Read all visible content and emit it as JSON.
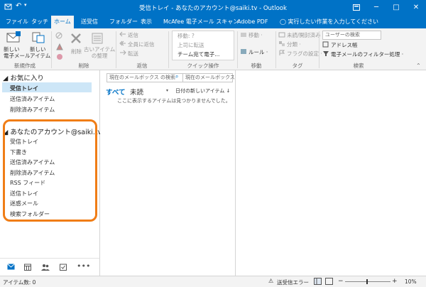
{
  "title_bar": {
    "title": "受信トレイ - あなたのアカウント@saiki.tv - Outlook",
    "ribbon_options_icon": "ribbon-display-options-icon",
    "minimize": "─",
    "maximize": "□",
    "close": "✕"
  },
  "tabs": [
    {
      "label": "ファイル"
    },
    {
      "label": "タッチ"
    },
    {
      "label": "ホーム"
    },
    {
      "label": "送受信"
    },
    {
      "label": "フォルダー"
    },
    {
      "label": "表示"
    },
    {
      "label": "McAfee 電子メール スキャン"
    },
    {
      "label": "Adobe PDF"
    }
  ],
  "tell_me": "実行したい作業を入力してください",
  "ribbon": {
    "new_email": "新しい\n電子メール",
    "new_items": "新しい\nアイテム",
    "group_new": "新規作成",
    "delete": "削除",
    "cleanup": "古いアイテム\nの整理",
    "group_delete": "削除",
    "reply": "返信",
    "reply_all": "全員に返信",
    "forward": "転送",
    "group_respond": "返信",
    "quick_move": "移動: ?",
    "quick_forward": "上司に転送",
    "quick_team": "チーム宛て電子...",
    "group_quick": "クイック操作",
    "move": "移動 ·",
    "rules": "ルール ·",
    "group_move": "移動",
    "unread": "未読/開封済み",
    "categorize": "分類 ·",
    "flag": "フラグの設定 ·",
    "group_tags": "タグ",
    "search_user": "ユーザーの検索",
    "address_book": "アドレス帳",
    "filter": "電子メールのフィルター処理 ·",
    "group_find": "検索"
  },
  "nav": {
    "favorites_header": "お気に入り",
    "favorites": [
      "受信トレイ",
      "送信済みアイテム",
      "削除済みアイテム"
    ],
    "account_header": "あなたのアカウント@saiki.tv",
    "folders": [
      "受信トレイ",
      "下書き",
      "送信済みアイテム",
      "削除済みアイテム",
      "RSS フィード",
      "送信トレイ",
      "迷惑メール",
      "検索フォルダー"
    ],
    "highlight_color": "#f07d16"
  },
  "list": {
    "search_placeholder": "現在のメールボックス の検索",
    "scope": "現在のメールボックス",
    "filter_all": "すべて",
    "filter_unread": "未読",
    "sort": "日付の新しいアイテム ↓",
    "empty_message": "ここに表示するアイテムは見つかりませんでした。"
  },
  "status": {
    "item_count": "アイテム数: 0",
    "sync_error": "送受信エラー",
    "zoom": "10%"
  },
  "colors": {
    "accent": "#0072c6",
    "ribbon_bg": "#f3f3f3"
  }
}
